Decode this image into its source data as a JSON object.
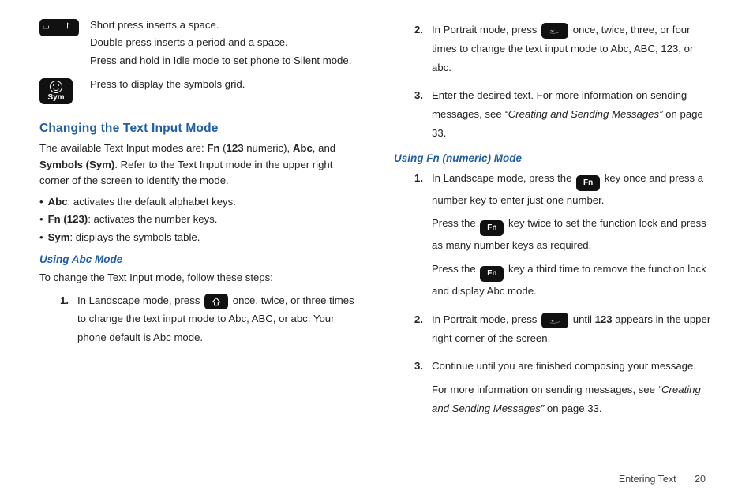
{
  "left": {
    "space_key": {
      "glyph": "⌴  ⨡",
      "lines": [
        "Short press inserts a space.",
        "Double press inserts a period and a space.",
        "Press and hold in Idle mode to set phone to Silent mode."
      ]
    },
    "sym_key": {
      "label": "Sym",
      "desc": "Press to display the symbols grid."
    },
    "heading": "Changing the Text Input Mode",
    "intro_pre": "The available Text Input modes are: ",
    "intro_fn": "Fn",
    "intro_paren_open": " (",
    "intro_123": "123",
    "intro_paren_close": " numeric), ",
    "intro_abc": "Abc",
    "intro_and": ", and ",
    "intro_sym": "Symbols (Sym)",
    "intro_tail": ". Refer to the Text Input mode in the upper right corner of the screen to identify the mode.",
    "bullets": [
      {
        "bold": "Abc",
        "rest": ": activates the default alphabet keys."
      },
      {
        "bold": "Fn (123)",
        "rest": ": activates the number keys."
      },
      {
        "bold": "Sym",
        "rest": ": displays the symbols table."
      }
    ],
    "subhead": "Using Abc Mode",
    "instr": "To change the Text Input mode, follow these steps:",
    "step1_pre": "In Landscape mode, press ",
    "step1_mid": " once, twice, or three times to change the text input mode to Abc, ABC, or abc. Your phone default is Abc mode."
  },
  "right": {
    "step2_pre": "In Portrait mode, press ",
    "step2_post": " once, twice, three, or four times to change the text input mode to Abc, ABC, 123, or abc.",
    "step3_pre": "Enter the desired text. For more information on sending messages, see ",
    "step3_ref": "“Creating and Sending Messages”",
    "step3_post": " on page 33.",
    "subhead": "Using Fn (numeric) Mode",
    "fn_label": "Fn",
    "fn1_pre": "In Landscape mode, press the ",
    "fn1_post": " key once and press a number key to enter just one number.",
    "fn1b_pre": "Press the ",
    "fn1b_post": " key twice to set the function lock and press as many number keys as required.",
    "fn1c_pre": "Press the ",
    "fn1c_post": " key a third time to remove the function lock and display Abc mode.",
    "fn2_pre": "In Portrait mode, press ",
    "fn2_mid": " until ",
    "fn2_bold": "123",
    "fn2_post": " appears in the upper right corner of the screen.",
    "fn3a": "Continue until you are finished composing your message.",
    "fn3b_pre": "For more information on sending messages, see ",
    "fn3b_ref": "“Creating and Sending Messages”",
    "fn3b_post": " on page 33."
  },
  "footer": {
    "section": "Entering Text",
    "page": "20"
  }
}
